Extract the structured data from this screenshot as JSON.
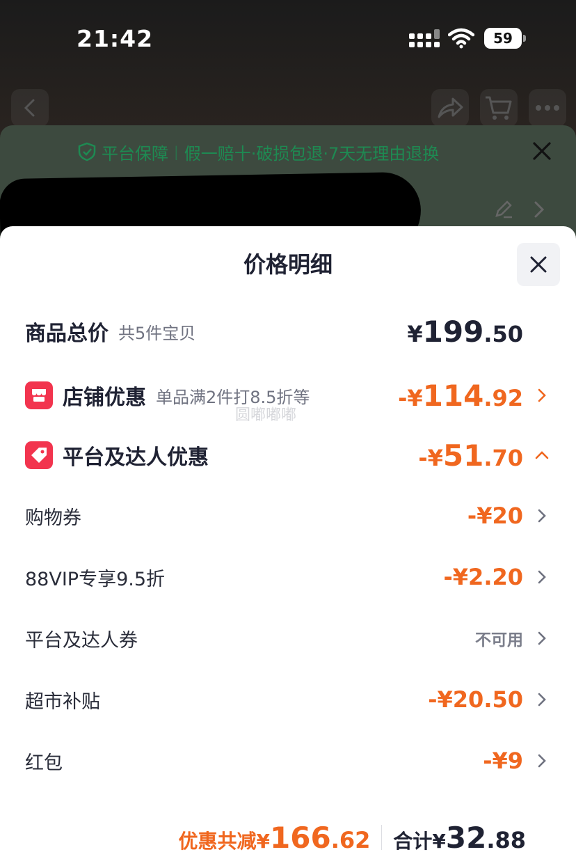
{
  "status_bar": {
    "time": "21:42",
    "battery": "59"
  },
  "guarantee": {
    "title": "平台保障",
    "detail": "假一赔十·破损包退·7天无理由退换"
  },
  "sheet": {
    "title": "价格明细",
    "watermark": "圆嘟嘟嘟",
    "rows": {
      "total_goods": {
        "label": "商品总价",
        "sub": "共5件宝贝",
        "currency": "¥",
        "int": "199",
        "dec": ".50"
      },
      "store_discount": {
        "label": "店铺优惠",
        "sub": "单品满2件打8.5折等",
        "currency": "-¥",
        "int": "114",
        "dec": ".92"
      },
      "platform_discount": {
        "label": "平台及达人优惠",
        "currency": "-¥",
        "int": "51",
        "dec": ".70"
      },
      "coupon": {
        "label": "购物券",
        "value": "-¥20"
      },
      "vip": {
        "label": "88VIP专享9.5折",
        "value": "-¥2.20"
      },
      "platform_coupon": {
        "label": "平台及达人券",
        "value": "不可用"
      },
      "supermarket": {
        "label": "超市补贴",
        "value": "-¥20.50"
      },
      "red_packet": {
        "label": "红包",
        "value": "-¥9"
      }
    },
    "footer": {
      "saving_label": "优惠共减¥",
      "saving_int": "166",
      "saving_dec": ".62",
      "total_label": "合计¥",
      "total_int": "32",
      "total_dec": ".88"
    }
  },
  "colors": {
    "accent_orange": "#f0671f",
    "badge_red": "#f2344e",
    "guarantee_green": "#1e8a52"
  }
}
